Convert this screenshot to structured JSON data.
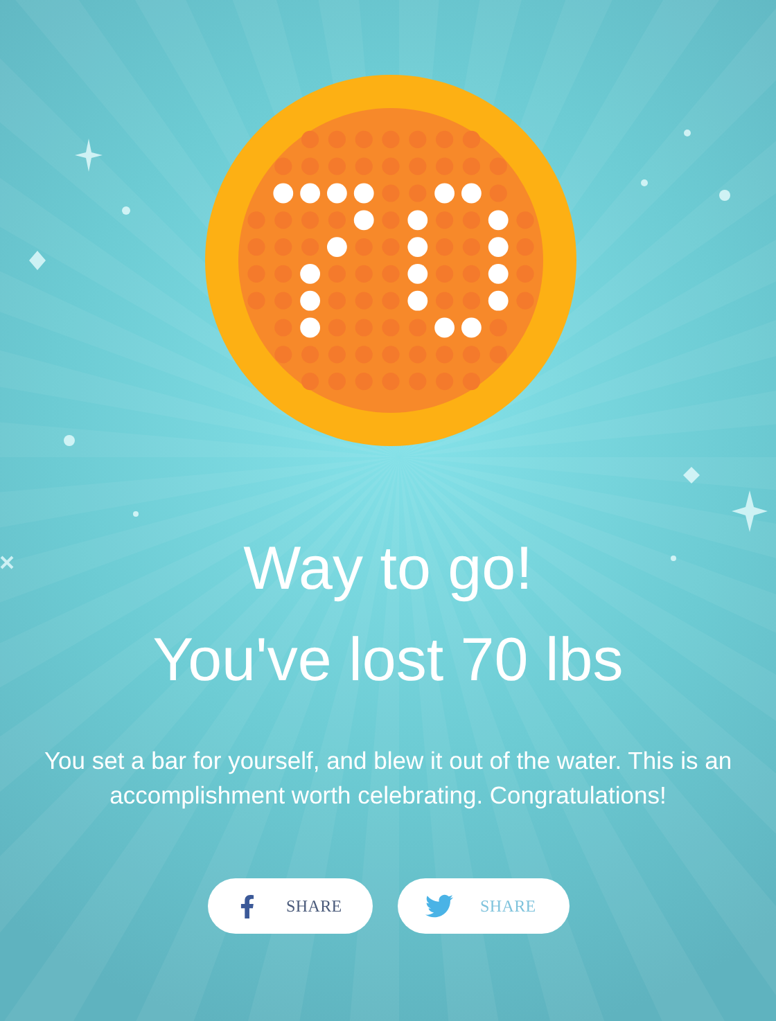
{
  "headline": "Way to go!",
  "subheadline": "You've lost 70 lbs",
  "message": "You set a bar for yourself, and blew it out of the water. This is an accomplishment worth celebrating. Congratulations!",
  "share_buttons": [
    {
      "kind": "facebook",
      "label": "SHARE"
    },
    {
      "kind": "twitter",
      "label": "SHARE"
    }
  ]
}
